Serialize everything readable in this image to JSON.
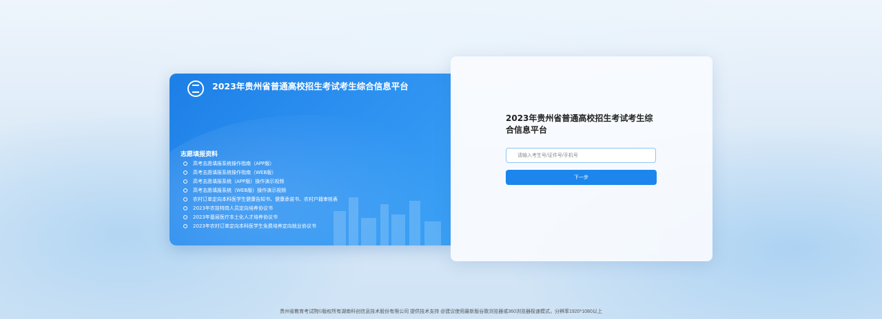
{
  "left_panel": {
    "title": "2023年贵州省普通高校招生考试考生综合信息平台",
    "resources_heading": "志愿填报资料",
    "resources": [
      "高考志愿填报系统操作指南（APP版）",
      "高考志愿填报系统操作指南（WEB版）",
      "高考志愿填报系统（APP版）操作演示视频",
      "高考志愿填报系统（WEB版）操作演示视频",
      "农村订单定向本科医学生健康告知书、健康承诺书、农村户籍审核表",
      "2023年农技特岗人员定向培养协议书",
      "2023年基层医疗本土化人才培养协议书",
      "2023年农村订单定向本科医学生免费培养定向就业协议书"
    ]
  },
  "login": {
    "title": "2023年贵州省普通高校招生考试考生综合信息平台",
    "input_placeholder": "请输入考生号/证件号/手机号",
    "next_button": "下一步"
  },
  "footer": {
    "text": "贵州省教育考试院©版权所有湖南科创信息技术股份有限公司 提供技术支持 @建议使用最新版谷歌浏览器或360浏览器极速模式，分辨率1920*1080以上"
  }
}
